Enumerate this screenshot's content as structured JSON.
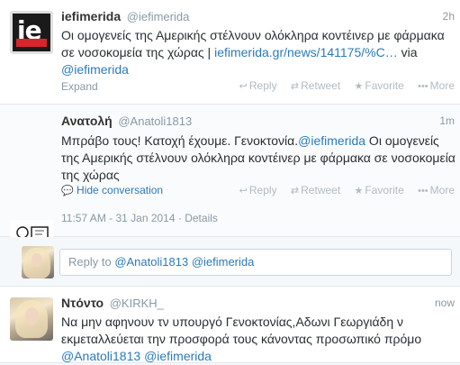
{
  "tweets": [
    {
      "name": "iefimerida",
      "handle": "@iefimerida",
      "time": "2h",
      "text_plain": "Οι ομογενείς της Αμερικής στέλνουν ολόκληρα κοντέινερ με φάρμακα σε νοσοκομεία της χώρας | ",
      "text_link": "iefimerida.gr/news/141175/%C…",
      "text_via": " via",
      "text_mention": "@iefimerida",
      "expand": "Expand"
    },
    {
      "name": "Ανατολή",
      "handle": "@Anatoli1813",
      "time": "1m",
      "text_plain": "Μπράβο τους! Κατοχή έχουμε. Γενοκτονία.",
      "text_mention": "@iefimerida",
      "text_rest": " Οι ομογενείς της Αμερικής στέλνουν ολόκληρα κοντέινερ με φάρμακα σε νοσοκομεία της χώρας",
      "hide": "Hide conversation",
      "datetime": "11:57 AM - 31 Jan 2014",
      "separator": " · ",
      "details": "Details"
    },
    {
      "name": "Ντόντο",
      "handle": "@KIRKH_",
      "time": "now",
      "text_plain": "Να μην αφηνουν τν υπουργό Γενοκτονίας,Αδωνι Γεωργιάδη ν εκμεταλλεύεται την προσφορά τους κάνοντας προσωπικό πρόμο ",
      "text_mention1": "@Anatoli1813",
      "text_mention2": "@iefimerida"
    }
  ],
  "actions": {
    "reply": "Reply",
    "retweet": "Retweet",
    "favorite": "Favorite",
    "more": "More"
  },
  "reply_box": {
    "prefix": "Reply to ",
    "mention1": "@Anatoli1813",
    "mention2": "@iefimerida"
  },
  "avatar_logo": "ie",
  "icons": {
    "reply": "reply-arrow-icon",
    "retweet": "retweet-icon",
    "favorite": "star-icon",
    "more": "dots-icon",
    "hide": "speech-bubble-icon"
  },
  "colors": {
    "link": "#2b7bb9",
    "muted": "#8899a6",
    "logo_red": "#d7262b"
  }
}
